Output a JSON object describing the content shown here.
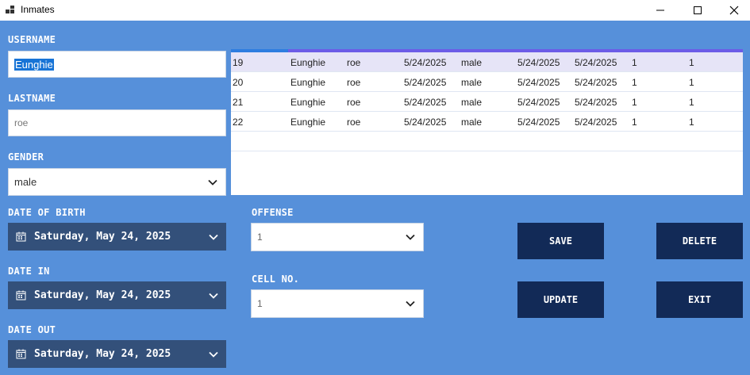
{
  "window": {
    "title": "Inmates"
  },
  "form": {
    "username_label": "USERNAME",
    "username_value": "Eunghie",
    "lastname_label": "LASTNAME",
    "lastname_value": "roe",
    "gender_label": "GENDER",
    "gender_value": "male",
    "dob_label": "DATE OF BIRTH",
    "dob_value": "Saturday, May 24, 2025",
    "date_in_label": "DATE IN",
    "date_in_value": "Saturday, May 24, 2025",
    "date_out_label": "DATE OUT",
    "date_out_value": "Saturday, May 24, 2025",
    "offense_label": "OFFENSE",
    "offense_value": "1",
    "cell_label": "CELL NO.",
    "cell_value": "1"
  },
  "buttons": {
    "save": "SAVE",
    "delete": "DELETE",
    "update": "UPDATE",
    "exit": "EXIT"
  },
  "grid": {
    "rows": [
      [
        "19",
        "Eunghie",
        "roe",
        "5/24/2025",
        "male",
        "5/24/2025",
        "5/24/2025",
        "1",
        "1"
      ],
      [
        "20",
        "Eunghie",
        "roe",
        "5/24/2025",
        "male",
        "5/24/2025",
        "5/24/2025",
        "1",
        "1"
      ],
      [
        "21",
        "Eunghie",
        "roe",
        "5/24/2025",
        "male",
        "5/24/2025",
        "5/24/2025",
        "1",
        "1"
      ],
      [
        "22",
        "Eunghie",
        "roe",
        "5/24/2025",
        "male",
        "5/24/2025",
        "5/24/2025",
        "1",
        "1"
      ]
    ],
    "selected_row": 0
  },
  "colors": {
    "background": "#5690da",
    "button": "#122a57",
    "datepicker": "#33507a",
    "selection": "#1874d6"
  }
}
